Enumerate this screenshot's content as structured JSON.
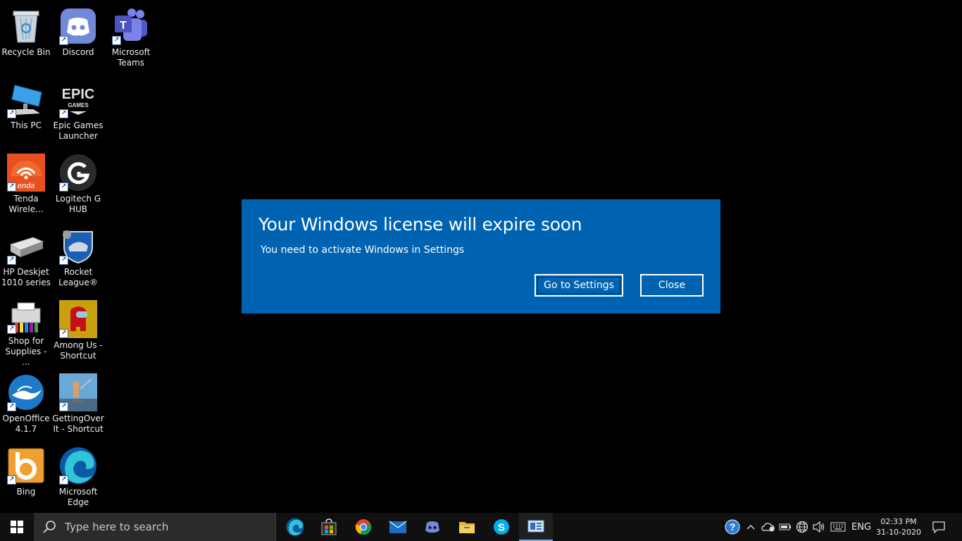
{
  "desktop": {
    "icons": [
      {
        "label": "Recycle Bin",
        "name": "recycle-bin-icon"
      },
      {
        "label": "Discord",
        "name": "discord-icon"
      },
      {
        "label": "Microsoft Teams",
        "name": "microsoft-teams-icon"
      },
      {
        "label": "This PC",
        "name": "this-pc-icon"
      },
      {
        "label": "Epic Games Launcher",
        "name": "epic-games-icon"
      },
      {
        "label": "Tenda Wirele...",
        "name": "tenda-wireless-icon"
      },
      {
        "label": "Logitech G HUB",
        "name": "logitech-g-hub-icon"
      },
      {
        "label": "HP Deskjet 1010 series",
        "name": "hp-deskjet-icon"
      },
      {
        "label": "Rocket League®",
        "name": "rocket-league-icon"
      },
      {
        "label": "Shop for Supplies - ...",
        "name": "shop-for-supplies-icon"
      },
      {
        "label": "Among Us - Shortcut",
        "name": "among-us-icon"
      },
      {
        "label": "OpenOffice 4.1.7",
        "name": "openoffice-icon"
      },
      {
        "label": "GettingOverIt - Shortcut",
        "name": "getting-over-it-icon"
      },
      {
        "label": "Bing",
        "name": "bing-icon"
      },
      {
        "label": "Microsoft Edge",
        "name": "microsoft-edge-icon"
      }
    ]
  },
  "dialog": {
    "title": "Your Windows license will expire soon",
    "message": "You need to activate Windows in Settings",
    "primary_button": "Go to Settings",
    "secondary_button": "Close",
    "background_color": "#0063b1"
  },
  "taskbar": {
    "search_placeholder": "Type here to search",
    "apps": [
      "edge-icon",
      "microsoft-store-icon",
      "chrome-icon",
      "mail-icon",
      "discord-icon",
      "file-explorer-icon",
      "skype-icon",
      "news-app-icon"
    ],
    "language": "ENG",
    "time": "02:33 PM",
    "date": "31-10-2020"
  }
}
